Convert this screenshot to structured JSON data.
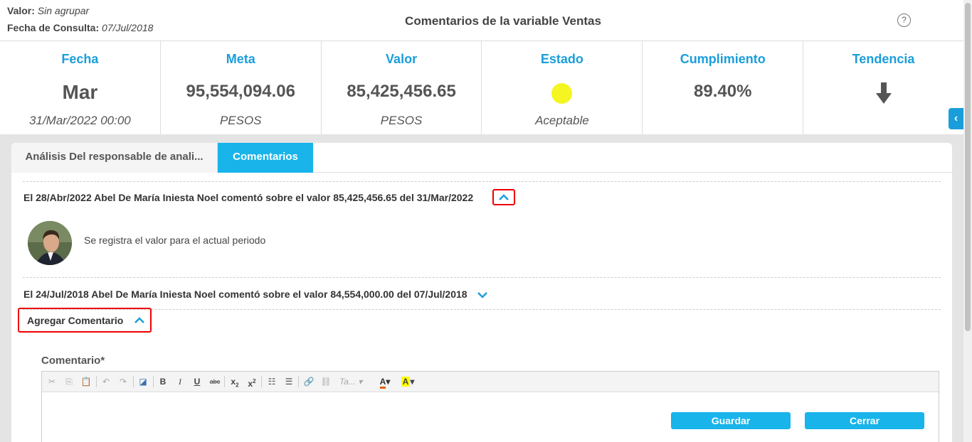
{
  "header": {
    "valor_label": "Valor:",
    "valor_value": "Sin agrupar",
    "fecha_label": "Fecha de Consulta:",
    "fecha_value": "07/Jul/2018",
    "title": "Comentarios de la variable Ventas",
    "help_icon": "?"
  },
  "summary": [
    {
      "label": "Fecha",
      "value": "Mar",
      "sub": "31/Mar/2022 00:00"
    },
    {
      "label": "Meta",
      "value": "95,554,094.06",
      "sub": "PESOS"
    },
    {
      "label": "Valor",
      "value": "85,425,456.65",
      "sub": "PESOS"
    },
    {
      "label": "Estado",
      "value": "",
      "sub": "Aceptable"
    },
    {
      "label": "Cumplimiento",
      "value": "89.40%",
      "sub": ""
    },
    {
      "label": "Tendencia",
      "value": "",
      "sub": ""
    }
  ],
  "colors": {
    "accent": "#18b4ea",
    "status": "#f5f521",
    "highlight": "#e00000"
  },
  "side_toggle": "‹",
  "tabs": [
    {
      "label": "Análisis Del responsable de anali...",
      "active": false
    },
    {
      "label": "Comentarios",
      "active": true
    }
  ],
  "comments": [
    {
      "header": "El 28/Abr/2022 Abel De María Iniesta Noel comentó sobre el valor 85,425,456.65 del 31/Mar/2022",
      "text": "Se registra el valor para el actual periodo",
      "expanded": true
    },
    {
      "header": "El 24/Jul/2018 Abel De María Iniesta Noel comentó sobre el valor 84,554,000.00 del 07/Jul/2018",
      "expanded": false
    }
  ],
  "add_comment": {
    "label": "Agregar Comentario",
    "field_label": "Comentario*",
    "font_select": "Ta...",
    "save_label": "Guardar",
    "close_label": "Cerrar"
  },
  "icons": [
    "cut-icon",
    "copy-icon",
    "paste-icon",
    "undo-icon",
    "redo-icon",
    "eraser-icon",
    "bold-icon",
    "italic-icon",
    "underline-icon",
    "strikethrough-icon",
    "subscript-icon",
    "superscript-icon",
    "numbered-list-icon",
    "bulleted-list-icon",
    "link-icon",
    "unlink-icon",
    "font-color-icon",
    "background-color-icon"
  ]
}
